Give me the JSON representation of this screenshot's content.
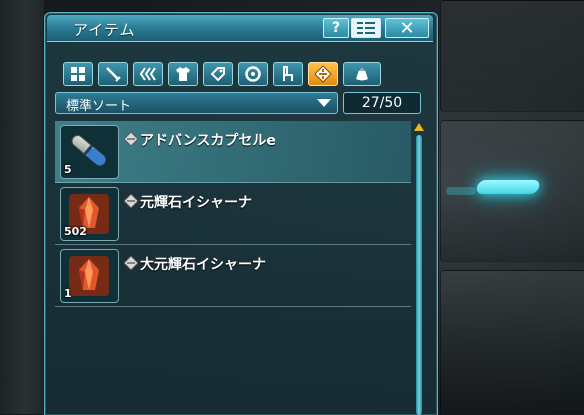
{
  "window": {
    "title": "アイテム",
    "help_label": "?",
    "close_label": "✕"
  },
  "category_tabs": [
    {
      "name": "all-items",
      "icon": "grid-icon",
      "active": false
    },
    {
      "name": "weapons",
      "icon": "sword-icon",
      "active": false
    },
    {
      "name": "units",
      "icon": "claw-icon",
      "active": false
    },
    {
      "name": "costumes",
      "icon": "shirt-icon",
      "active": false
    },
    {
      "name": "tickets",
      "icon": "tag-icon",
      "active": false
    },
    {
      "name": "discs",
      "icon": "disc-icon",
      "active": false
    },
    {
      "name": "furniture",
      "icon": "chair-icon",
      "active": false
    },
    {
      "name": "consumables",
      "icon": "diamond-arrows-icon",
      "active": true
    },
    {
      "name": "materials",
      "icon": "bag-icon",
      "active": false
    }
  ],
  "sort": {
    "label": "標準ソート",
    "count": "27/50"
  },
  "items": [
    {
      "name": "アドバンスカプセルe",
      "quantity": "5",
      "icon": "capsule-icon",
      "selected": true
    },
    {
      "name": "元輝石イシャーナ",
      "quantity": "502",
      "icon": "red-crystal-icon",
      "selected": false
    },
    {
      "name": "大元輝石イシャーナ",
      "quantity": "1",
      "icon": "red-crystal-icon",
      "selected": false
    }
  ],
  "colors": {
    "accent": "#2a7b93",
    "active_tab": "#f2a21f",
    "glow": "#3fd6e6"
  }
}
